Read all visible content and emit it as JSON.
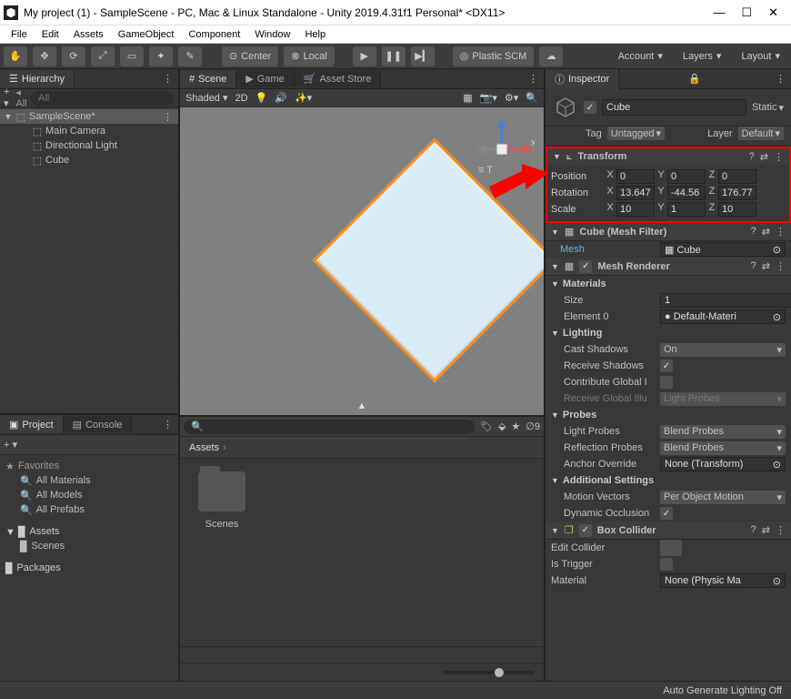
{
  "window": {
    "title": "My project (1) - SampleScene - PC, Mac & Linux Standalone - Unity 2019.4.31f1 Personal* <DX11>"
  },
  "menu": [
    "File",
    "Edit",
    "Assets",
    "GameObject",
    "Component",
    "Window",
    "Help"
  ],
  "toolbar": {
    "center": "Center",
    "local": "Local",
    "plastic": "Plastic SCM",
    "account": "Account",
    "layers": "Layers",
    "layout": "Layout"
  },
  "hierarchy": {
    "tab": "Hierarchy",
    "allLabel": "All",
    "scene": "SampleScene*",
    "items": [
      "Main Camera",
      "Directional Light",
      "Cube"
    ]
  },
  "project": {
    "projectTab": "Project",
    "consoleTab": "Console",
    "favorites": "Favorites",
    "favItems": [
      "All Materials",
      "All Models",
      "All Prefabs"
    ],
    "assets": "Assets",
    "assetsItems": [
      "Scenes"
    ],
    "packages": "Packages"
  },
  "scene": {
    "tabs": [
      "Scene",
      "Game",
      "Asset Store"
    ],
    "shaded": "Shaded",
    "mode2d": "2D"
  },
  "assetsPanel": {
    "breadcrumb": "Assets",
    "folder": "Scenes"
  },
  "inspector": {
    "tab": "Inspector",
    "name": "Cube",
    "static": "Static",
    "tagLabel": "Tag",
    "tag": "Untagged",
    "layerLabel": "Layer",
    "layer": "Default",
    "transform": {
      "title": "Transform",
      "rows": {
        "Position": {
          "x": "0",
          "y": "0",
          "z": "0"
        },
        "Rotation": {
          "x": "13.647",
          "y": "-44.56",
          "z": "176.77"
        },
        "Scale": {
          "x": "10",
          "y": "1",
          "z": "10"
        }
      }
    },
    "meshFilter": {
      "title": "Cube (Mesh Filter)",
      "meshLabel": "Mesh",
      "mesh": "Cube"
    },
    "meshRenderer": {
      "title": "Mesh Renderer",
      "materials": "Materials",
      "sizeLabel": "Size",
      "size": "1",
      "element0Label": "Element 0",
      "element0": "Default-Materi",
      "lighting": "Lighting",
      "castShadowsLabel": "Cast Shadows",
      "castShadows": "On",
      "receiveShadowsLabel": "Receive Shadows",
      "contributeGILabel": "Contribute Global I",
      "receiveGILabel": "Receive Global Illu",
      "receiveGI": "Light Probes",
      "probes": "Probes",
      "lightProbesLabel": "Light Probes",
      "lightProbes": "Blend Probes",
      "reflectionProbesLabel": "Reflection Probes",
      "reflectionProbes": "Blend Probes",
      "anchorOverrideLabel": "Anchor Override",
      "anchorOverride": "None (Transform)",
      "additional": "Additional Settings",
      "motionVectorsLabel": "Motion Vectors",
      "motionVectors": "Per Object Motion",
      "dynamicOcclusionLabel": "Dynamic Occlusion"
    },
    "boxCollider": {
      "title": "Box Collider",
      "editColliderLabel": "Edit Collider",
      "isTriggerLabel": "Is Trigger",
      "materialLabel": "Material",
      "material": "None (Physic Ma"
    }
  },
  "status": "Auto Generate Lighting Off"
}
